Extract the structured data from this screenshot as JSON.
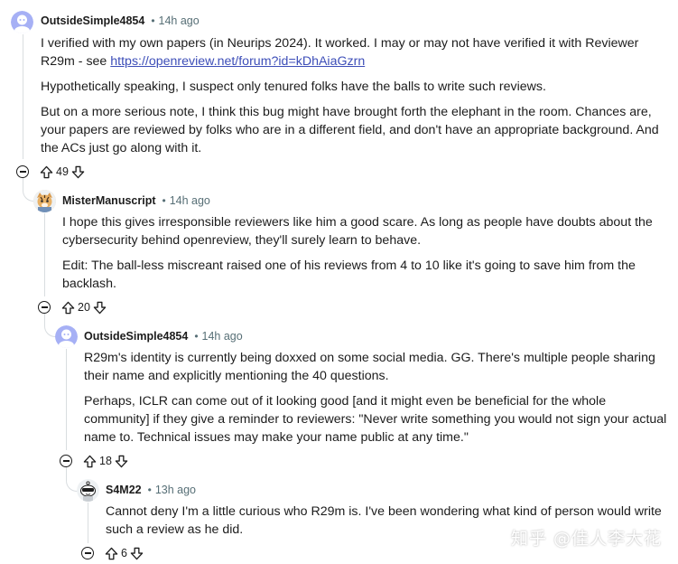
{
  "comments": [
    {
      "author": "OutsideSimple4854",
      "time": "14h ago",
      "paragraphs": [
        "I verified with my own papers (in Neurips 2024). It worked. I may or may not have verified it with Reviewer R29m - see ",
        "Hypothetically speaking, I suspect only tenured folks have the balls to write such reviews.",
        "But on a more serious note, I think this bug might have brought forth the elephant in the room. Chances are, your papers are reviewed by folks who are in a different field, and don't have an appropriate background. And the ACs just go along with it."
      ],
      "link": "https://openreview.net/forum?id=kDhAiaGzrn",
      "score": "49"
    },
    {
      "author": "MisterManuscript",
      "time": "14h ago",
      "paragraphs": [
        "I hope this gives irresponsible reviewers like him a good scare. As long as people have doubts about the cybersecurity behind openreview, they'll surely learn to behave.",
        "Edit: The ball-less miscreant raised one of his reviews from 4 to 10 like it's going to save him from the backlash."
      ],
      "score": "20"
    },
    {
      "author": "OutsideSimple4854",
      "time": "14h ago",
      "paragraphs": [
        "R29m's identity is currently being doxxed on some social media. GG. There's multiple people sharing their name and explicitly mentioning the 40 questions.",
        "Perhaps, ICLR can come out of it looking good [and it might even be beneficial for the whole community] if they give a reminder to reviewers: \"Never write something you would not sign your actual name to. Technical issues may make your name public at any time.\""
      ],
      "score": "18"
    },
    {
      "author": "S4M22",
      "time": "13h ago",
      "paragraphs": [
        "Cannot deny I'm a little curious who R29m is. I've been wondering what kind of person would write such a review as he did."
      ],
      "score": "6"
    }
  ],
  "watermark": "知乎 @佳人李大花",
  "colors": {
    "link": "#3d4eb8",
    "meta": "#576f76",
    "avatar_default": "#a6b0f5",
    "thread_line": "#d9dde0"
  },
  "icons": [
    "default-avatar-icon",
    "tiger-avatar-icon",
    "snoo-avatar-icon",
    "collapse-icon",
    "upvote-icon",
    "downvote-icon"
  ]
}
